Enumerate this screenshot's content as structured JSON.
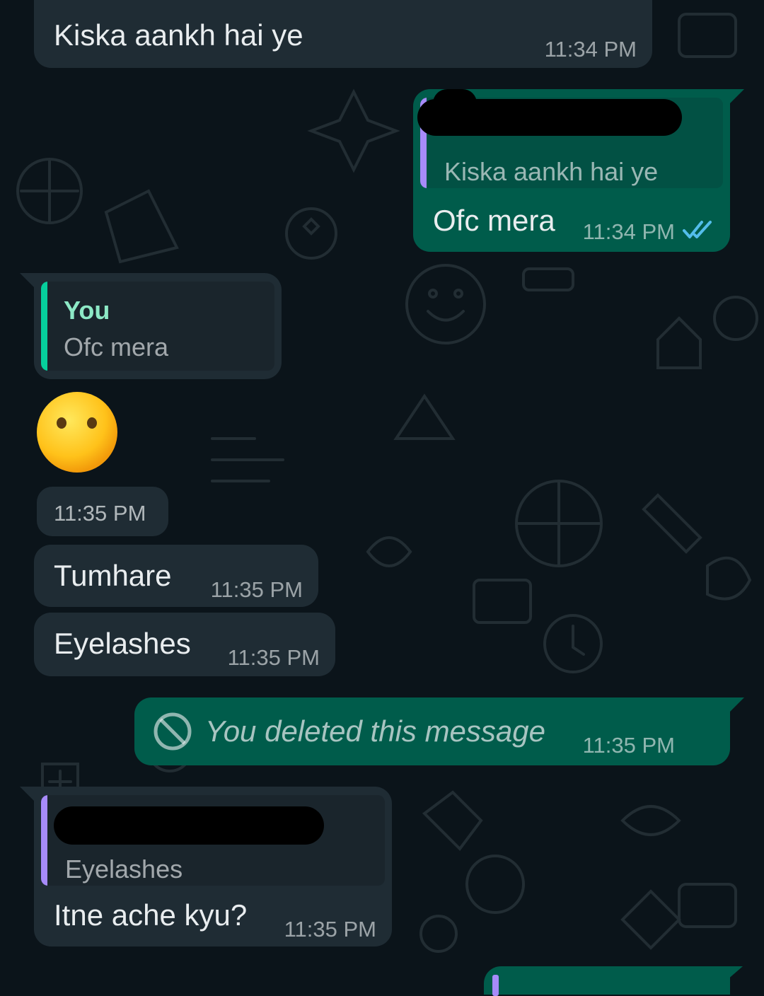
{
  "colors": {
    "background": "#0b141a",
    "incoming_bubble": "#1f2c34",
    "outgoing_bubble": "#005c4b",
    "read_ticks": "#53bdeb",
    "quote_bar_purple": "#a78bfa",
    "quote_bar_green": "#06cf9c",
    "quote_author_green": "#8de9c6"
  },
  "messages": [
    {
      "text": "Kiska aankh hai ye",
      "time": "11:34 PM"
    },
    {
      "quoted_text": "Kiska aankh hai ye",
      "text": "Ofc mera",
      "time": "11:34 PM",
      "status_icon": "double-check-read"
    },
    {
      "quoted_author": "You",
      "quoted_text": "Ofc mera"
    },
    {
      "emoji": "😶",
      "time": "11:35 PM"
    },
    {
      "text": "Tumhare",
      "time": "11:35 PM"
    },
    {
      "text": "Eyelashes",
      "time": "11:35 PM"
    },
    {
      "icon": "prohibited-icon",
      "text": "You deleted this message",
      "time": "11:35 PM"
    },
    {
      "quoted_text": "Eyelashes",
      "text": "Itne ache kyu?",
      "time": "11:35 PM"
    }
  ]
}
